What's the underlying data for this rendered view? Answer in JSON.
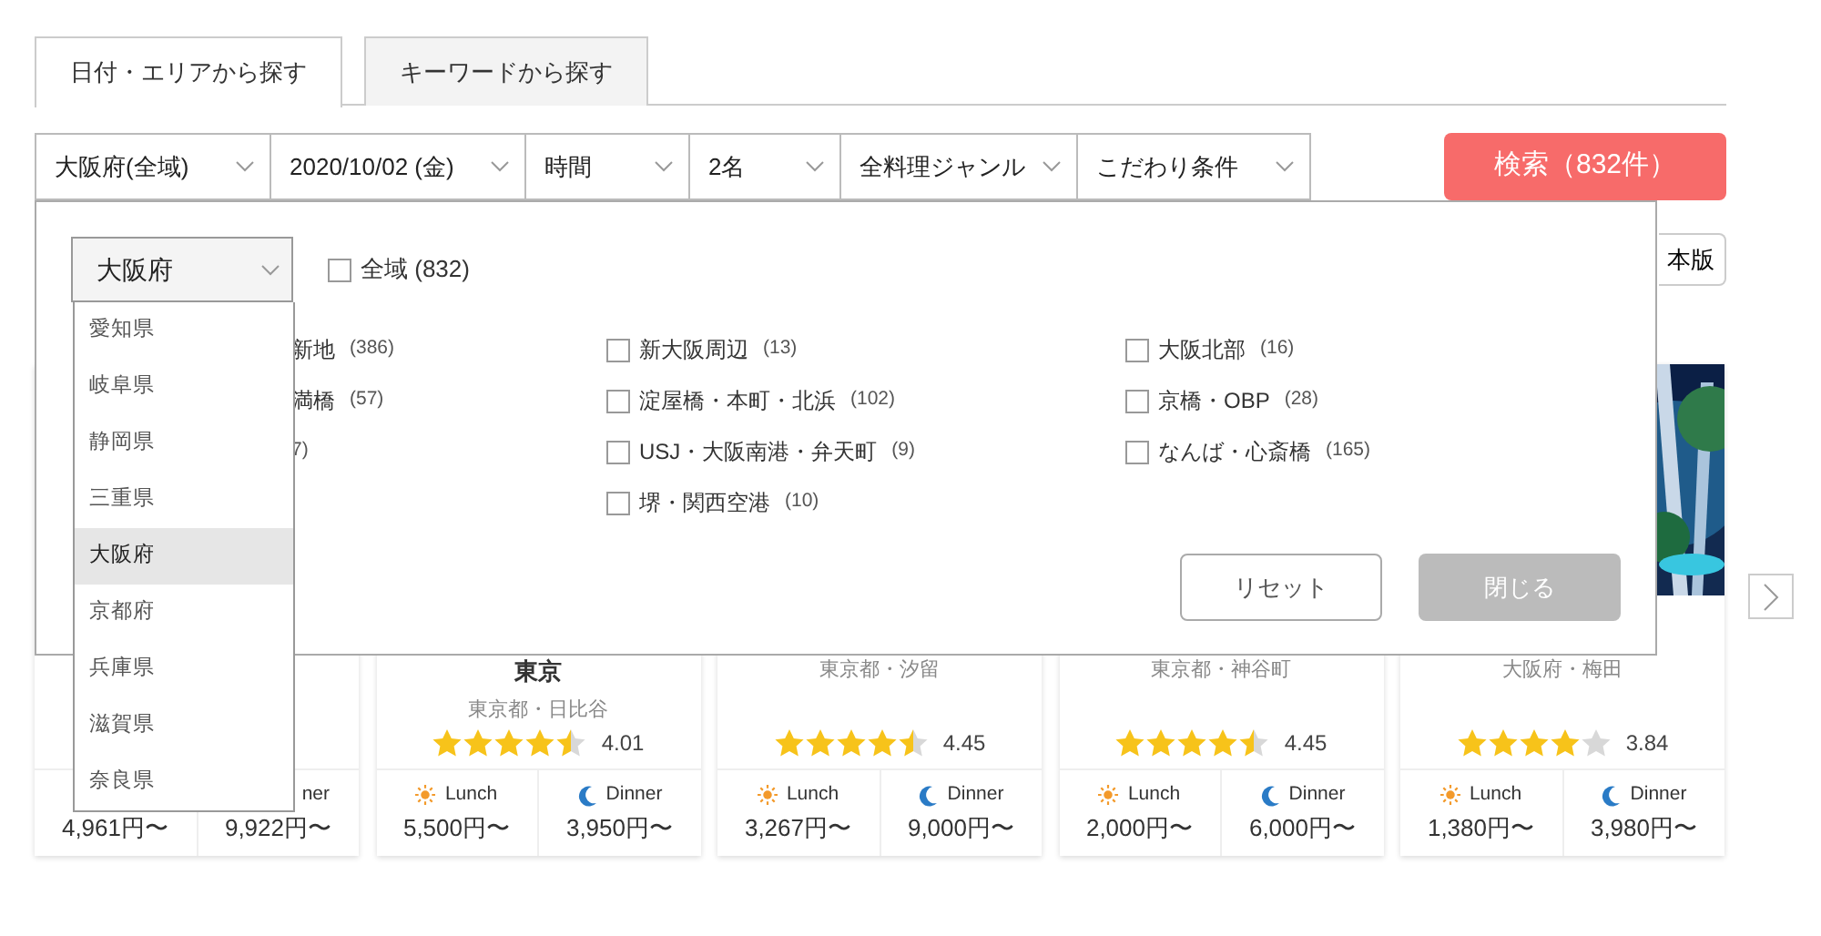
{
  "tabs": [
    {
      "label": "日付・エリアから探す",
      "selected": true
    },
    {
      "label": "キーワードから探す",
      "selected": false
    }
  ],
  "filters": [
    {
      "label": "大阪府(全域)"
    },
    {
      "label": "2020/10/02 (金)"
    },
    {
      "label": "時間"
    },
    {
      "label": "2名"
    },
    {
      "label": "全料理ジャンル"
    },
    {
      "label": "こだわり条件"
    }
  ],
  "search_button": "検索（832件）",
  "version_button": "本版",
  "area_panel": {
    "prefecture_select": "大阪府",
    "prefecture_options": [
      {
        "label": "愛知県",
        "selected": false
      },
      {
        "label": "岐阜県",
        "selected": false
      },
      {
        "label": "静岡県",
        "selected": false
      },
      {
        "label": "三重県",
        "selected": false
      },
      {
        "label": "大阪府",
        "selected": true
      },
      {
        "label": "京都府",
        "selected": false
      },
      {
        "label": "兵庫県",
        "selected": false
      },
      {
        "label": "滋賀県",
        "selected": false
      },
      {
        "label": "奈良県",
        "selected": false
      }
    ],
    "all_area": {
      "label": "全域 (832)",
      "checked": false
    },
    "area_columns": [
      [
        {
          "name": "新地",
          "count": "(386)"
        },
        {
          "name": "満橋",
          "count": "(57)"
        },
        {
          "count": "7)"
        }
      ],
      [
        {
          "name": "新大阪周辺",
          "count": "(13)",
          "checked": false
        },
        {
          "name": "淀屋橋・本町・北浜",
          "count": "(102)",
          "checked": false
        },
        {
          "name": "USJ・大阪南港・弁天町",
          "count": "(9)",
          "checked": false
        },
        {
          "name": "堺・関西空港",
          "count": "(10)",
          "checked": false
        }
      ],
      [
        {
          "name": "大阪北部",
          "count": "(16)",
          "checked": false
        },
        {
          "name": "京橋・OBP",
          "count": "(28)",
          "checked": false
        },
        {
          "name": "なんば・心斎橋",
          "count": "(165)",
          "checked": false
        }
      ]
    ],
    "reset_button": "リセット",
    "close_button": "閉じる"
  },
  "cards": [
    {
      "meals": [
        {
          "price": "4,961円〜"
        },
        {
          "label": "ner",
          "price": "9,922円〜"
        }
      ]
    },
    {
      "name": "東京",
      "location": "東京都・日比谷",
      "stars": 4.5,
      "rating": "4.01",
      "meals": [
        {
          "kind": "lunch",
          "label": "Lunch",
          "price": "5,500円〜"
        },
        {
          "kind": "dinner",
          "label": "Dinner",
          "price": "3,950円〜"
        }
      ]
    },
    {
      "location": "東京都・汐留",
      "stars": 4.5,
      "rating": "4.45",
      "meals": [
        {
          "kind": "lunch",
          "label": "Lunch",
          "price": "3,267円〜"
        },
        {
          "kind": "dinner",
          "label": "Dinner",
          "price": "9,000円〜"
        }
      ]
    },
    {
      "location": "東京都・神谷町",
      "stars": 4.5,
      "rating": "4.45",
      "meals": [
        {
          "kind": "lunch",
          "label": "Lunch",
          "price": "2,000円〜"
        },
        {
          "kind": "dinner",
          "label": "Dinner",
          "price": "6,000円〜"
        }
      ]
    },
    {
      "image": {
        "kind": "picture"
      },
      "location": "大阪府・梅田",
      "stars": 4,
      "rating": "3.84",
      "meals": [
        {
          "kind": "lunch",
          "label": "Lunch",
          "price": "1,380円〜"
        },
        {
          "kind": "dinner",
          "label": "Dinner",
          "price": "3,980円〜"
        }
      ]
    }
  ]
}
